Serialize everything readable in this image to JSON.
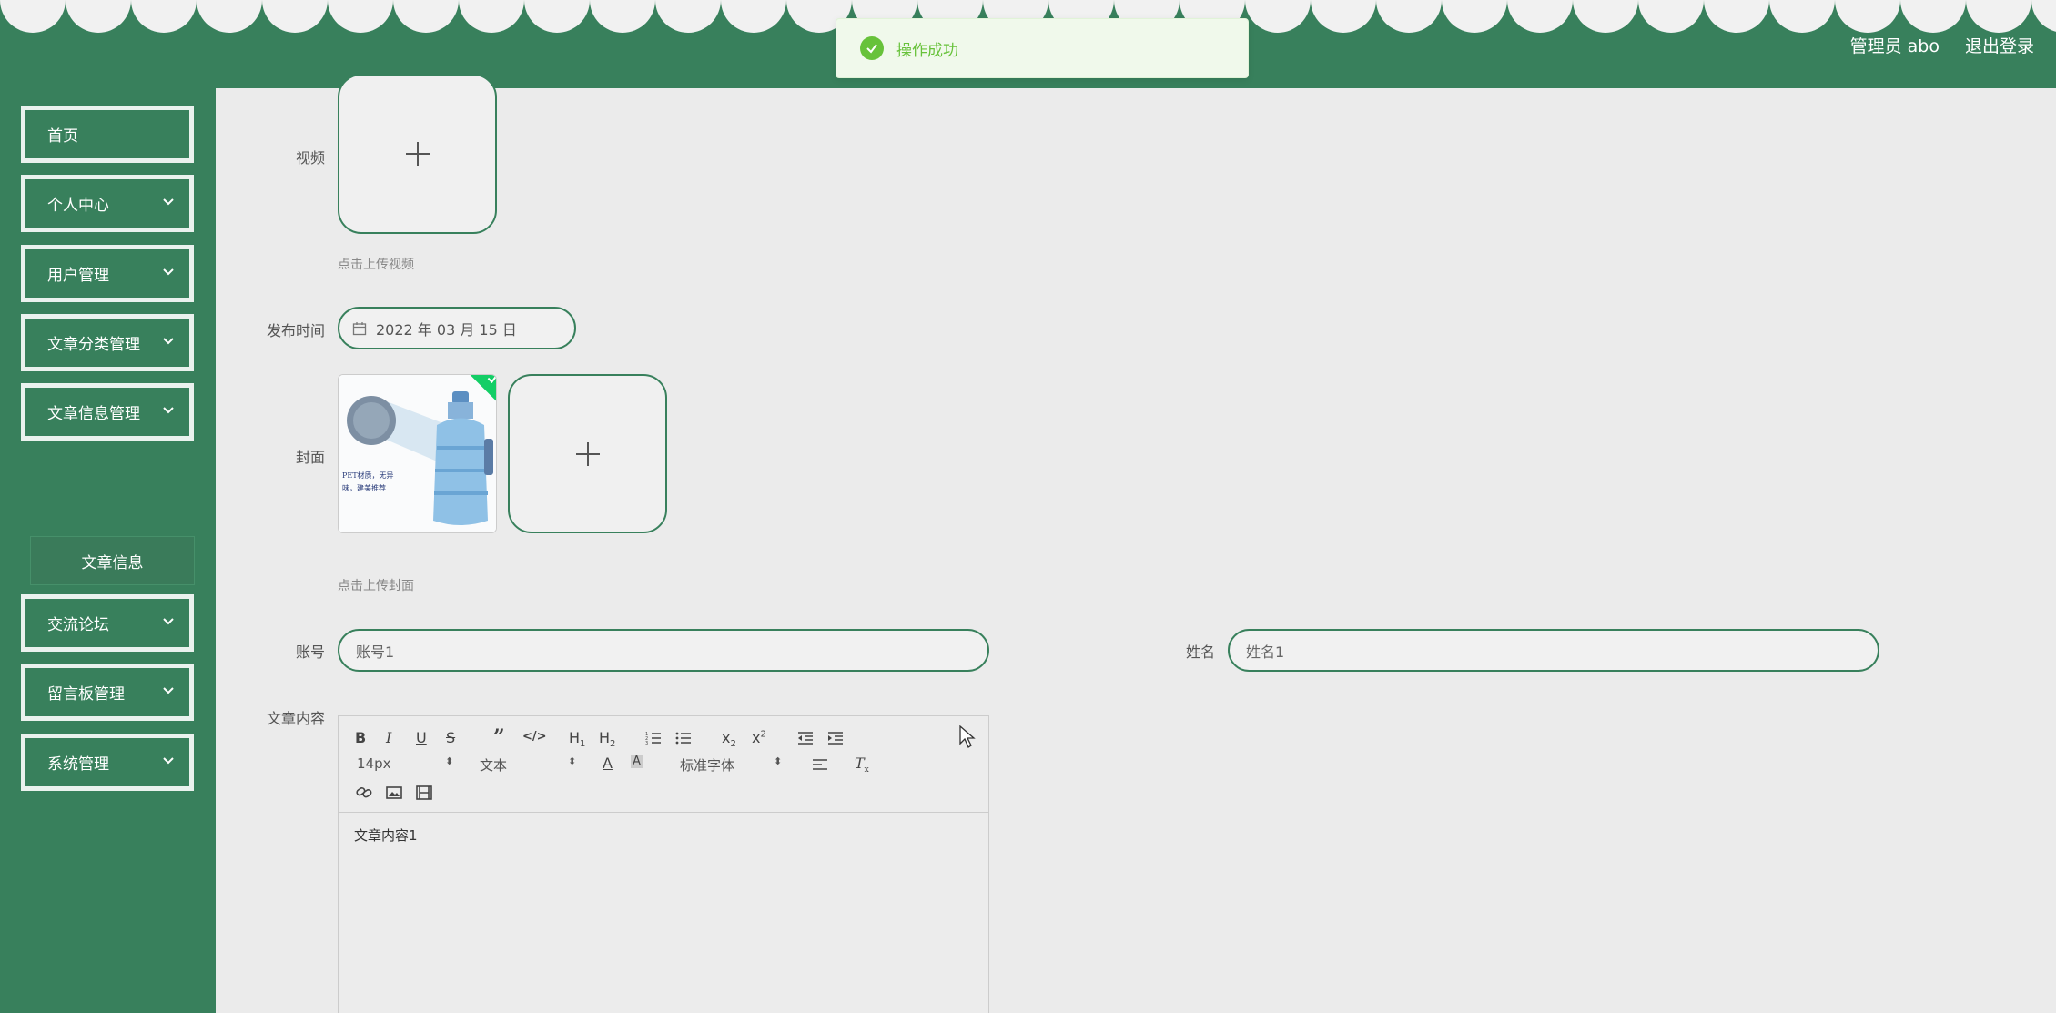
{
  "header": {
    "admin_label": "管理员 abo",
    "logout_label": "退出登录"
  },
  "toast": {
    "message": "操作成功"
  },
  "sidebar": {
    "items": [
      {
        "label": "首页"
      },
      {
        "label": "个人中心"
      },
      {
        "label": "用户管理"
      },
      {
        "label": "文章分类管理"
      },
      {
        "label": "文章信息管理"
      },
      {
        "label": "交流论坛"
      },
      {
        "label": "留言板管理"
      },
      {
        "label": "系统管理"
      }
    ],
    "submenu_label": "文章信息"
  },
  "form": {
    "video_label": "视频",
    "video_hint": "点击上传视频",
    "publish_time_label": "发布时间",
    "publish_time_value": "2022 年 03 月 15 日",
    "cover_label": "封面",
    "cover_hint": "点击上传封面",
    "cover_image_caption": "PET材质，无异味，建美推荐",
    "account_label": "账号",
    "account_value": "账号1",
    "name_label": "姓名",
    "name_value": "姓名1",
    "content_label": "文章内容",
    "content_value": "文章内容1"
  },
  "editor": {
    "font_size": "14px",
    "block_type": "文本",
    "font_family": "标准字体"
  }
}
